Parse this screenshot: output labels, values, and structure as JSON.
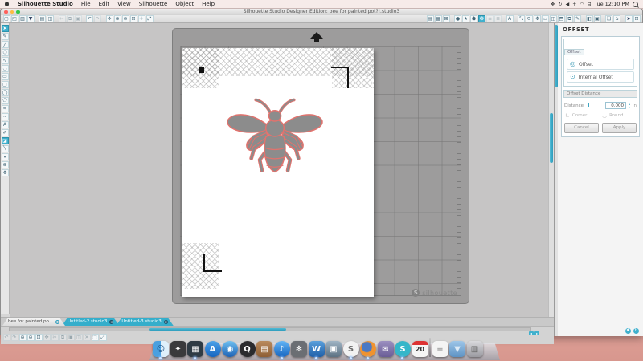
{
  "menubar": {
    "items": [
      {
        "name": "menu-silhouette-studio",
        "label": "Silhouette Studio",
        "cls": "bold"
      },
      {
        "name": "menu-file",
        "label": "File"
      },
      {
        "name": "menu-edit",
        "label": "Edit"
      },
      {
        "name": "menu-view",
        "label": "View"
      },
      {
        "name": "menu-silhouette",
        "label": "Silhouette"
      },
      {
        "name": "menu-object",
        "label": "Object"
      },
      {
        "name": "menu-help",
        "label": "Help"
      }
    ],
    "status_icons": [
      {
        "name": "app-menulet-icon",
        "glyph": "❖"
      },
      {
        "name": "sync-menulet-icon",
        "glyph": "↻"
      },
      {
        "name": "volume-menulet-icon",
        "glyph": "◀"
      },
      {
        "name": "plus-menulet-icon",
        "glyph": "+"
      },
      {
        "name": "wifi-menulet-icon",
        "glyph": "◠"
      },
      {
        "name": "display-menulet-icon",
        "glyph": "⊟"
      }
    ],
    "clock": "Tue 12:10 PM"
  },
  "window": {
    "title": "Silhouette Studio Designer Edition: bee for painted pot?!.studio3"
  },
  "toolbar": {
    "left": [
      {
        "name": "new-document-icon",
        "glyph": "▢"
      },
      {
        "name": "open-file-icon",
        "glyph": "◰"
      },
      {
        "name": "open-library-icon",
        "glyph": "▥"
      },
      {
        "name": "save-icon",
        "glyph": "▼",
        "cls": "dark"
      },
      {
        "name": "print-icon",
        "glyph": "▤",
        "cls": "gap"
      },
      {
        "name": "print-preview-icon",
        "glyph": "◫"
      },
      {
        "name": "cut-icon",
        "glyph": "✂",
        "disabled": true,
        "cls": "gap"
      },
      {
        "name": "copy-icon",
        "glyph": "⧉",
        "disabled": true
      },
      {
        "name": "paste-icon",
        "glyph": "▣",
        "disabled": true
      },
      {
        "name": "undo-icon",
        "glyph": "↶",
        "cls": "gap"
      },
      {
        "name": "redo-icon",
        "glyph": "↷",
        "disabled": true
      },
      {
        "name": "drag-icon",
        "glyph": "✥",
        "cls": "gap"
      },
      {
        "name": "zoom-in-icon",
        "glyph": "⊕"
      },
      {
        "name": "zoom-out-icon",
        "glyph": "⊖"
      },
      {
        "name": "zoom-selection-icon",
        "glyph": "⊡"
      },
      {
        "name": "pan-icon",
        "glyph": "✛"
      },
      {
        "name": "fit-to-page-icon",
        "glyph": "⤢"
      }
    ],
    "right": [
      {
        "name": "page-setup-icon",
        "glyph": "▤"
      },
      {
        "name": "cutting-mat-icon",
        "glyph": "▦"
      },
      {
        "name": "registration-marks-icon",
        "glyph": "⊞"
      },
      {
        "name": "fill-color-icon",
        "glyph": "●",
        "cls": "gap"
      },
      {
        "name": "line-color-icon",
        "glyph": "★"
      },
      {
        "name": "sketch-pens-icon",
        "glyph": "⬟"
      },
      {
        "name": "offset-icon",
        "glyph": "❂",
        "active": true
      },
      {
        "name": "shadow-icon",
        "glyph": "≡",
        "disabled": true
      },
      {
        "name": "distribute-icon",
        "glyph": "≣",
        "disabled": true
      },
      {
        "name": "text-style-icon",
        "glyph": "A",
        "cls": "gap"
      },
      {
        "name": "scale-icon",
        "glyph": "⤡",
        "cls": "gap"
      },
      {
        "name": "rotate-icon",
        "glyph": "⟳"
      },
      {
        "name": "move-icon",
        "glyph": "✥"
      },
      {
        "name": "shear-icon",
        "glyph": "▱"
      },
      {
        "name": "weld-icon",
        "glyph": "◫"
      },
      {
        "name": "modify-icon",
        "glyph": "⬒"
      },
      {
        "name": "replicate-icon",
        "glyph": "⧉"
      },
      {
        "name": "object-on-path-icon",
        "glyph": "✎"
      },
      {
        "name": "trace-icon",
        "glyph": "◧",
        "cls": "gap"
      },
      {
        "name": "trace-area-icon",
        "glyph": "▣"
      },
      {
        "name": "library-panel-icon",
        "glyph": "❏",
        "cls": "gap"
      },
      {
        "name": "store-panel-icon",
        "glyph": "⌂"
      }
    ],
    "far_right": [
      {
        "name": "cursor-settings-icon",
        "glyph": "➤",
        "cls": "gap dark"
      },
      {
        "name": "display-settings-icon",
        "glyph": "⊡"
      }
    ]
  },
  "left_toolbar": [
    {
      "name": "select-tool-icon",
      "glyph": "➤",
      "active": true
    },
    {
      "name": "edit-points-tool-icon",
      "glyph": "✎"
    },
    {
      "name": "line-tool-icon",
      "glyph": "╱",
      "cls": "gap2"
    },
    {
      "name": "polygon-tool-icon",
      "glyph": "⬡"
    },
    {
      "name": "curve-tool-icon",
      "glyph": "∿"
    },
    {
      "name": "arc-tool-icon",
      "glyph": "◡"
    },
    {
      "name": "rectangle-tool-icon",
      "glyph": "▭"
    },
    {
      "name": "rounded-rectangle-tool-icon",
      "glyph": "▢"
    },
    {
      "name": "ellipse-tool-icon",
      "glyph": "◯"
    },
    {
      "name": "regular-polygon-tool-icon",
      "glyph": "⬠"
    },
    {
      "name": "freehand-tool-icon",
      "glyph": "≈"
    },
    {
      "name": "smooth-freehand-tool-icon",
      "glyph": "~"
    },
    {
      "name": "text-tool-icon",
      "glyph": "A"
    },
    {
      "name": "note-tool-icon",
      "glyph": "✐"
    },
    {
      "name": "eraser-tool-icon",
      "glyph": "◪",
      "active": true,
      "cls": "gap2"
    },
    {
      "name": "knife-tool-icon",
      "glyph": "╲"
    },
    {
      "name": "pick-color-tool-icon",
      "glyph": "▾"
    },
    {
      "name": "zoom-tool-icon",
      "glyph": "⊕",
      "cls": "gap2"
    },
    {
      "name": "pan-tool-icon",
      "glyph": "✥"
    }
  ],
  "canvas": {
    "watermark_s": "S",
    "watermark": "silhouette"
  },
  "offset_panel": {
    "title": "OFFSET",
    "group_label": "Offset",
    "options": [
      {
        "name": "offset-option",
        "glyph": "◎",
        "label": "Offset"
      },
      {
        "name": "internal-offset-option",
        "glyph": "⊙",
        "label": "Internal Offset"
      }
    ],
    "distance_section_label": "Offset Distance",
    "distance_label": "Distance",
    "distance_value": "0.000",
    "stepper_up": "▴",
    "stepper_down": "▾",
    "unit": "in",
    "corner": {
      "glyph": "∟",
      "label": "Corner"
    },
    "round": {
      "glyph": "◡",
      "label": "Round"
    },
    "cancel_label": "Cancel",
    "apply_label": "Apply",
    "footer_icons": [
      {
        "name": "panel-settings-icon",
        "glyph": "✱"
      },
      {
        "name": "panel-refresh-icon",
        "glyph": "↻"
      }
    ]
  },
  "tabs": [
    {
      "name": "tab-bee-document",
      "label": "bee for painted po...",
      "active": true
    },
    {
      "name": "tab-untitled-2",
      "label": "Untitled-2.studio3"
    },
    {
      "name": "tab-untitled-3",
      "label": "Untitled-3.studio3"
    }
  ],
  "bottom_toolbar": [
    {
      "name": "bottom-undo-icon",
      "glyph": "↶",
      "disabled": true
    },
    {
      "name": "bottom-redo-icon",
      "glyph": "↷",
      "disabled": true
    },
    {
      "name": "bottom-zoom-in-icon",
      "glyph": "⊕"
    },
    {
      "name": "bottom-zoom-out-icon",
      "glyph": "⊖"
    },
    {
      "name": "bottom-zoom-selection-icon",
      "glyph": "⊡"
    },
    {
      "name": "bottom-pan-icon",
      "glyph": "✥",
      "disabled": true
    },
    {
      "name": "bottom-cut-icon",
      "glyph": "✂",
      "disabled": true
    },
    {
      "name": "bottom-copy-icon",
      "glyph": "⧉",
      "disabled": true
    },
    {
      "name": "bottom-paste-icon",
      "glyph": "▣",
      "disabled": true
    },
    {
      "name": "bottom-duplicate-icon",
      "glyph": "◫",
      "disabled": true
    },
    {
      "name": "bottom-delete-icon",
      "glyph": "✕",
      "disabled": true
    },
    {
      "name": "bottom-group-icon",
      "glyph": "⬚"
    },
    {
      "name": "bottom-fit-icon",
      "glyph": "⤢"
    }
  ],
  "scroll": {
    "left_arrow": "◂",
    "right_arrow": "▸",
    "tab_close": "✕"
  },
  "dock": {
    "items": [
      {
        "name": "dock-finder-icon",
        "glyph": "☺",
        "cls": "finder",
        "running": true
      },
      {
        "name": "dock-launchpad-icon",
        "glyph": "✦",
        "bg": "#3a3a3c"
      },
      {
        "name": "dock-mission-control-icon",
        "glyph": "▦",
        "bg": "#2f3b44",
        "running": true
      },
      {
        "name": "dock-app-store-icon",
        "glyph": "A",
        "bg": "linear-gradient(#4da2e8,#1565c0)",
        "cls": "circle"
      },
      {
        "name": "dock-safari-icon",
        "glyph": "◉",
        "bg": "linear-gradient(#6fc0f0,#1e62b5)",
        "cls": "circle"
      },
      {
        "name": "dock-quicktime-icon",
        "glyph": "Q",
        "bg": "#2b2b2e",
        "cls": "circle"
      },
      {
        "name": "dock-contacts-icon",
        "glyph": "▤",
        "bg": "linear-gradient(#b98a5c,#8f5f36)"
      },
      {
        "name": "dock-itunes-icon",
        "glyph": "♪",
        "bg": "linear-gradient(#64b5f6,#1565c0)",
        "cls": "circle",
        "running": true
      },
      {
        "name": "dock-system-preferences-icon",
        "glyph": "✻",
        "bg": "#6b6e73"
      },
      {
        "name": "dock-word-icon",
        "glyph": "W",
        "bg": "linear-gradient(#5aa0dc,#1f5fa8)",
        "running": true
      },
      {
        "name": "dock-photo-booth-icon",
        "glyph": "▣",
        "bg": "linear-gradient(#9fb4c4,#5d7283)"
      },
      {
        "name": "dock-silhouette-studio-icon",
        "glyph": "S",
        "bg": "#f2f2f2",
        "fg": "#6d6d6d",
        "cls": "circle",
        "running": true
      },
      {
        "name": "dock-firefox-icon",
        "glyph": "",
        "bg": "radial-gradient(circle at 42% 38%, #4a79c4 0 34%, #f0932f 42% 72%, #d45f18 100%)",
        "cls": "circle",
        "running": true
      },
      {
        "name": "dock-mail-icon",
        "glyph": "✉",
        "bg": "linear-gradient(#9b8fc0,#6a5d96)"
      },
      {
        "name": "dock-silhouette-connect-icon",
        "glyph": "S",
        "bg": "#35b6c9",
        "cls": "circle",
        "running": true
      },
      {
        "name": "dock-calendar-icon",
        "glyph": "20",
        "cls": "calendar"
      },
      {
        "name": "dock-divider",
        "cls": "divider"
      },
      {
        "name": "dock-document-icon",
        "glyph": "≡",
        "bg": "#f4f4f4",
        "fg": "#888"
      },
      {
        "name": "dock-downloads-folder-icon",
        "glyph": "▼",
        "bg": "linear-gradient(#9ec6e8,#5e93c4)",
        "fg": "#dceaf6"
      },
      {
        "name": "dock-trash-icon",
        "glyph": "▥",
        "bg": "linear-gradient(#d9d9dc,#9a9aa0)",
        "fg": "#666"
      }
    ]
  },
  "colors": {
    "accent": "#2fa8c8",
    "mat_gray": "#9d9c9c",
    "bee_fill": "#8c8c8c",
    "bee_outline": "#e0736e"
  }
}
